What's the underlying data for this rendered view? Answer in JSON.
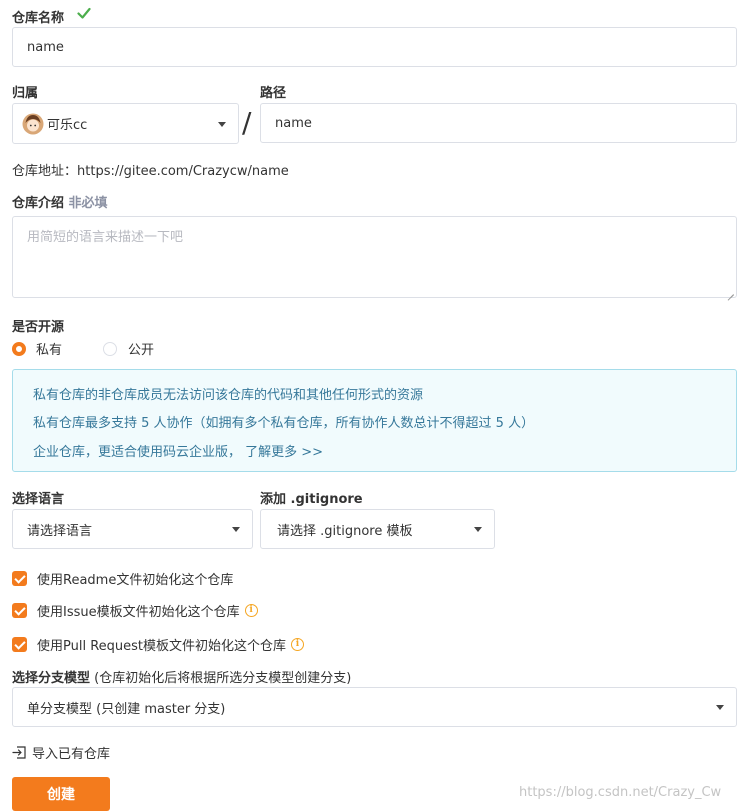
{
  "repo_name": {
    "label": "仓库名称",
    "value": "name"
  },
  "owner": {
    "label": "归属",
    "selected": "可乐cc"
  },
  "path": {
    "label": "路径",
    "separator": "/",
    "value": "name"
  },
  "repo_url": {
    "prefix": "仓库地址：",
    "url": "https://gitee.com/Crazycw/name"
  },
  "description": {
    "label": "仓库介绍",
    "optional": "非必填",
    "placeholder": "用简短的语言来描述一下吧"
  },
  "open_source": {
    "label": "是否开源",
    "options": [
      "私有",
      "公开"
    ],
    "selected": "私有"
  },
  "notice": {
    "lines": [
      "私有仓库的非仓库成员无法访问该仓库的代码和其他任何形式的资源",
      "私有仓库最多支持 5 人协作（如拥有多个私有仓库，所有协作人数总计不得超过 5 人）",
      "企业仓库，更适合使用码云企业版，  了解更多 >>"
    ]
  },
  "language": {
    "label": "选择语言",
    "selected": "请选择语言"
  },
  "gitignore": {
    "label": "添加 .gitignore",
    "selected": "请选择 .gitignore 模板"
  },
  "init_options": [
    {
      "label": "使用Readme文件初始化这个仓库",
      "checked": true
    },
    {
      "label": "使用Issue模板文件初始化这个仓库",
      "checked": true
    },
    {
      "label": "使用Pull Request模板文件初始化这个仓库",
      "checked": true
    }
  ],
  "branch_model": {
    "label": "选择分支模型",
    "hint": "(仓库初始化后将根据所选分支模型创建分支)",
    "selected": "单分支模型 (只创建 master 分支)"
  },
  "import_link": "导入已有仓库",
  "create_button": "创建",
  "watermark": "https://blog.csdn.net/Crazy_Cw",
  "colors": {
    "accent": "#f37b1d",
    "success": "#4cae4c",
    "notice_bg": "#f1fbfd",
    "notice_border": "#a5dcea",
    "notice_text": "#36789a"
  },
  "icons": [
    "check-icon",
    "avatar",
    "caret-down-icon",
    "info-icon",
    "import-icon"
  ]
}
